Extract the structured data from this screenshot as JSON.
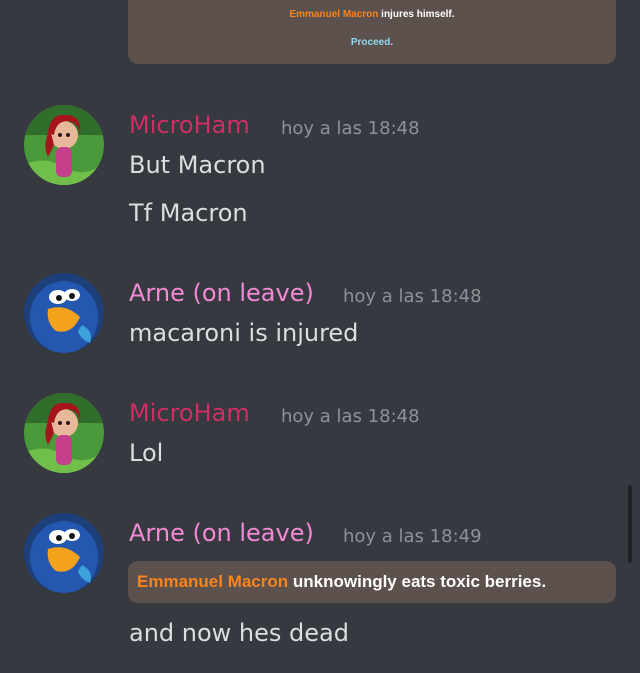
{
  "top_embed": {
    "actor": "Emmanuel Macron",
    "action": " injures himself.",
    "proceed": "Proceed."
  },
  "messages": [
    {
      "author": "MicroHam",
      "timestamp": "hoy a las 18:48",
      "lines": [
        "But Macron",
        "Tf Macron"
      ]
    },
    {
      "author": "Arne (on leave)",
      "timestamp": "hoy a las 18:48",
      "lines": [
        "macaroni is injured"
      ]
    },
    {
      "author": "MicroHam",
      "timestamp": "hoy a las 18:48",
      "lines": [
        "Lol"
      ]
    },
    {
      "author": "Arne (on leave)",
      "timestamp": "hoy a las 18:49",
      "embed": {
        "actor": "Emmanuel Macron",
        "action": " unknowingly eats toxic berries."
      },
      "lines": [
        "and now hes dead"
      ]
    }
  ],
  "colors": {
    "background": "#36393f",
    "microham": "#d12d67",
    "arne": "#f289d4",
    "embed_bg": "#5c514d",
    "actor_orange": "#f8841c",
    "proceed_cyan": "#8ed9ef"
  }
}
